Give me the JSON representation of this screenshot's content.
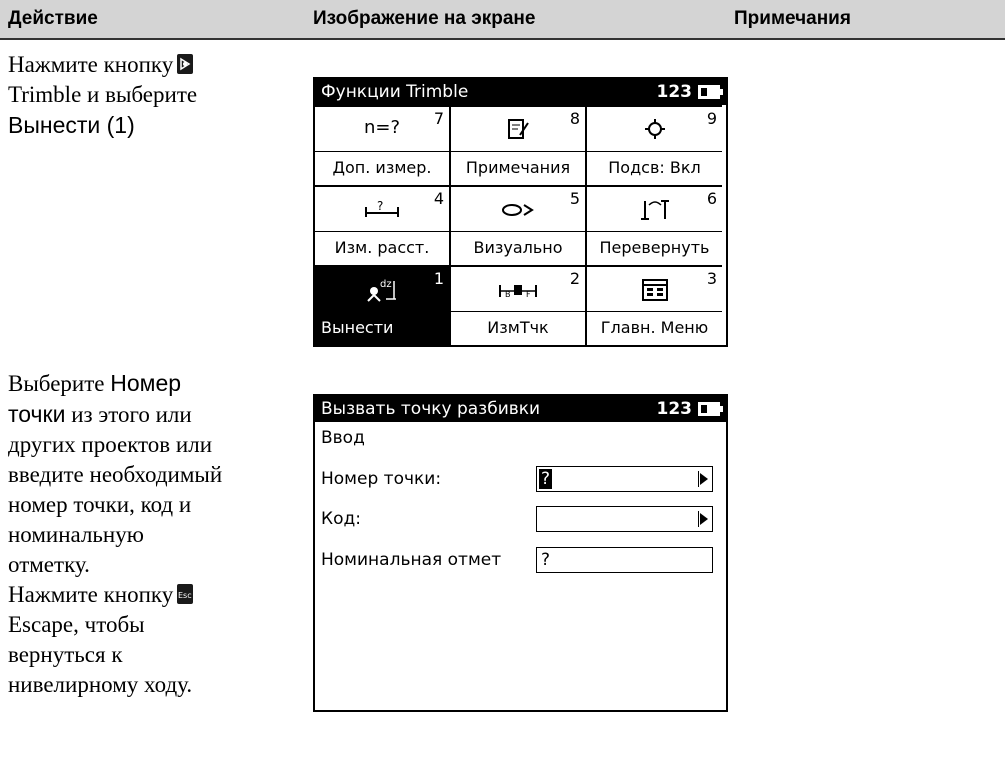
{
  "header": {
    "col1": "Действие",
    "col2": "Изображение на экране",
    "col3": "Примечания"
  },
  "step1": {
    "line1": "Нажмите кнопку",
    "line2": "Trimble и выберите",
    "line3": "Вынести (1)",
    "button_icon": "trimble-key-icon"
  },
  "step2": {
    "line1a": "Выберите ",
    "line1b": "Номер",
    "line2a": "точки",
    "line2b": " из этого или",
    "line3": "других проектов или",
    "line4": "введите необходимый",
    "line5": "номер точки, код и",
    "line6": "номинальную",
    "line7": "отметку.",
    "line8": "Нажмите кнопку",
    "line9": "Escape, чтобы",
    "line10": "вернуться к",
    "line11": "нивелирному ходу.",
    "button_icon": "esc-key-icon"
  },
  "screen1": {
    "title": "Функции Trimble",
    "indicator": "123",
    "cells": [
      {
        "num": "7",
        "icon": "n=?",
        "label": "Доп. измер."
      },
      {
        "num": "8",
        "icon": "notes-icon",
        "label": "Примечания"
      },
      {
        "num": "9",
        "icon": "backlight-icon",
        "label": "Подсв: Вкл"
      },
      {
        "num": "4",
        "icon": "measure-distance-icon",
        "label": "Изм. расст."
      },
      {
        "num": "5",
        "icon": "visual-icon",
        "label": "Визуально"
      },
      {
        "num": "6",
        "icon": "invert-icon",
        "label": "Перевернуть"
      },
      {
        "num": "1",
        "icon": "stakeout-icon",
        "label": "Вынести"
      },
      {
        "num": "2",
        "icon": "measure-point-icon",
        "label": "ИзмТчк"
      },
      {
        "num": "3",
        "icon": "main-menu-icon",
        "label": "Главн. Меню"
      }
    ]
  },
  "screen2": {
    "title": "Вызвать точку разбивки",
    "indicator": "123",
    "subtitle": "Ввод",
    "fields": [
      {
        "label": "Номер точки:",
        "value": "?"
      },
      {
        "label": "Код:",
        "value": ""
      },
      {
        "label": "Номинальная отмет",
        "value": "?"
      }
    ]
  }
}
